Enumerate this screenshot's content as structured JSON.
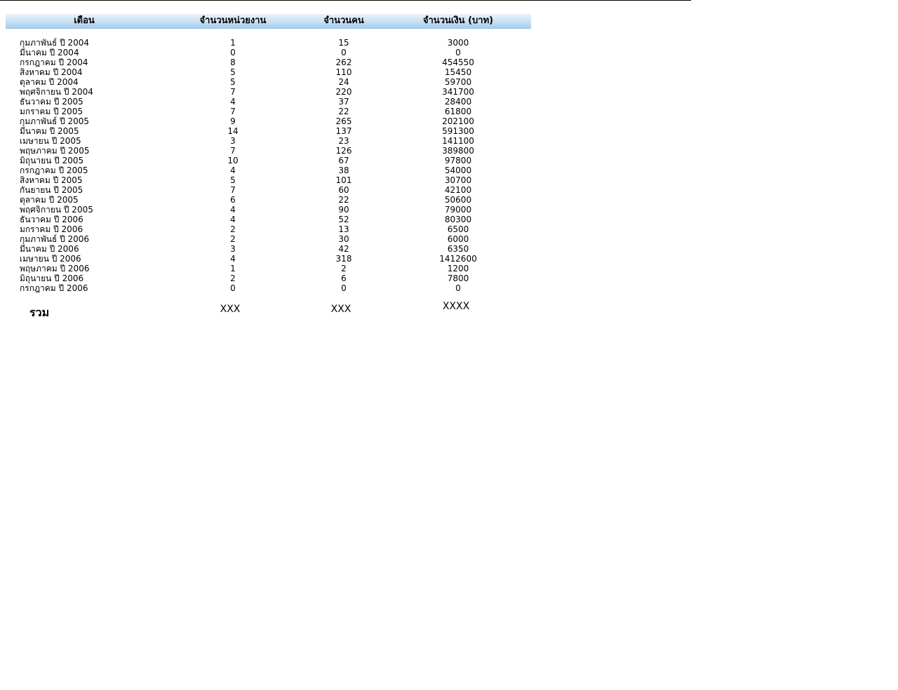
{
  "header": {
    "month": "เดือน",
    "units": "จำนวนหน่วยงาน",
    "people": "จำนวนคน",
    "money": "จำนวนเงิน (บาท)"
  },
  "rows": [
    {
      "month": "กุมภาพันธ์ ปี 2004",
      "units": "1",
      "people": "15",
      "money": "3000"
    },
    {
      "month": "มีนาคม ปี 2004",
      "units": "0",
      "people": "0",
      "money": "0"
    },
    {
      "month": "กรกฎาคม ปี 2004",
      "units": "8",
      "people": "262",
      "money": "454550"
    },
    {
      "month": "สิงหาคม ปี 2004",
      "units": "5",
      "people": "110",
      "money": "15450"
    },
    {
      "month": "ตุลาคม ปี 2004",
      "units": "5",
      "people": "24",
      "money": "59700"
    },
    {
      "month": "พฤศจิกายน ปี 2004",
      "units": "7",
      "people": "220",
      "money": "341700"
    },
    {
      "month": "ธันวาคม ปี 2005",
      "units": "4",
      "people": "37",
      "money": "28400"
    },
    {
      "month": "มกราคม ปี 2005",
      "units": "7",
      "people": "22",
      "money": "61800"
    },
    {
      "month": "กุมภาพันธ์ ปี 2005",
      "units": "9",
      "people": "265",
      "money": "202100"
    },
    {
      "month": "มีนาคม ปี 2005",
      "units": "14",
      "people": "137",
      "money": "591300"
    },
    {
      "month": "เมษายน ปี 2005",
      "units": "3",
      "people": "23",
      "money": "141100"
    },
    {
      "month": "พฤษภาคม ปี 2005",
      "units": "7",
      "people": "126",
      "money": "389800"
    },
    {
      "month": "มิถุนายน ปี 2005",
      "units": "10",
      "people": "67",
      "money": "97800"
    },
    {
      "month": "กรกฎาคม ปี 2005",
      "units": "4",
      "people": "38",
      "money": "54000"
    },
    {
      "month": "สิงหาคม ปี 2005",
      "units": "5",
      "people": "101",
      "money": "30700"
    },
    {
      "month": "กันยายน ปี 2005",
      "units": "7",
      "people": "60",
      "money": "42100"
    },
    {
      "month": "ตุลาคม ปี 2005",
      "units": "6",
      "people": "22",
      "money": "50600"
    },
    {
      "month": "พฤศจิกายน ปี 2005",
      "units": "4",
      "people": "90",
      "money": "79000"
    },
    {
      "month": "ธันวาคม ปี 2006",
      "units": "4",
      "people": "52",
      "money": "80300"
    },
    {
      "month": "มกราคม ปี 2006",
      "units": "2",
      "people": "13",
      "money": "6500"
    },
    {
      "month": "กุมภาพันธ์ ปี 2006",
      "units": "2",
      "people": "30",
      "money": "6000"
    },
    {
      "month": "มีนาคม ปี 2006",
      "units": "3",
      "people": "42",
      "money": "6350"
    },
    {
      "month": "เมษายน ปี 2006",
      "units": "4",
      "people": "318",
      "money": "1412600"
    },
    {
      "month": "พฤษภาคม ปี 2006",
      "units": "1",
      "people": "2",
      "money": "1200"
    },
    {
      "month": "มิถุนายน ปี 2006",
      "units": "2",
      "people": "6",
      "money": "7800"
    },
    {
      "month": "กรกฎาคม ปี 2006",
      "units": "0",
      "people": "0",
      "money": "0"
    }
  ],
  "total": {
    "label": "รวม",
    "units": "XXX",
    "people": "XXX",
    "money": "XXXX"
  }
}
